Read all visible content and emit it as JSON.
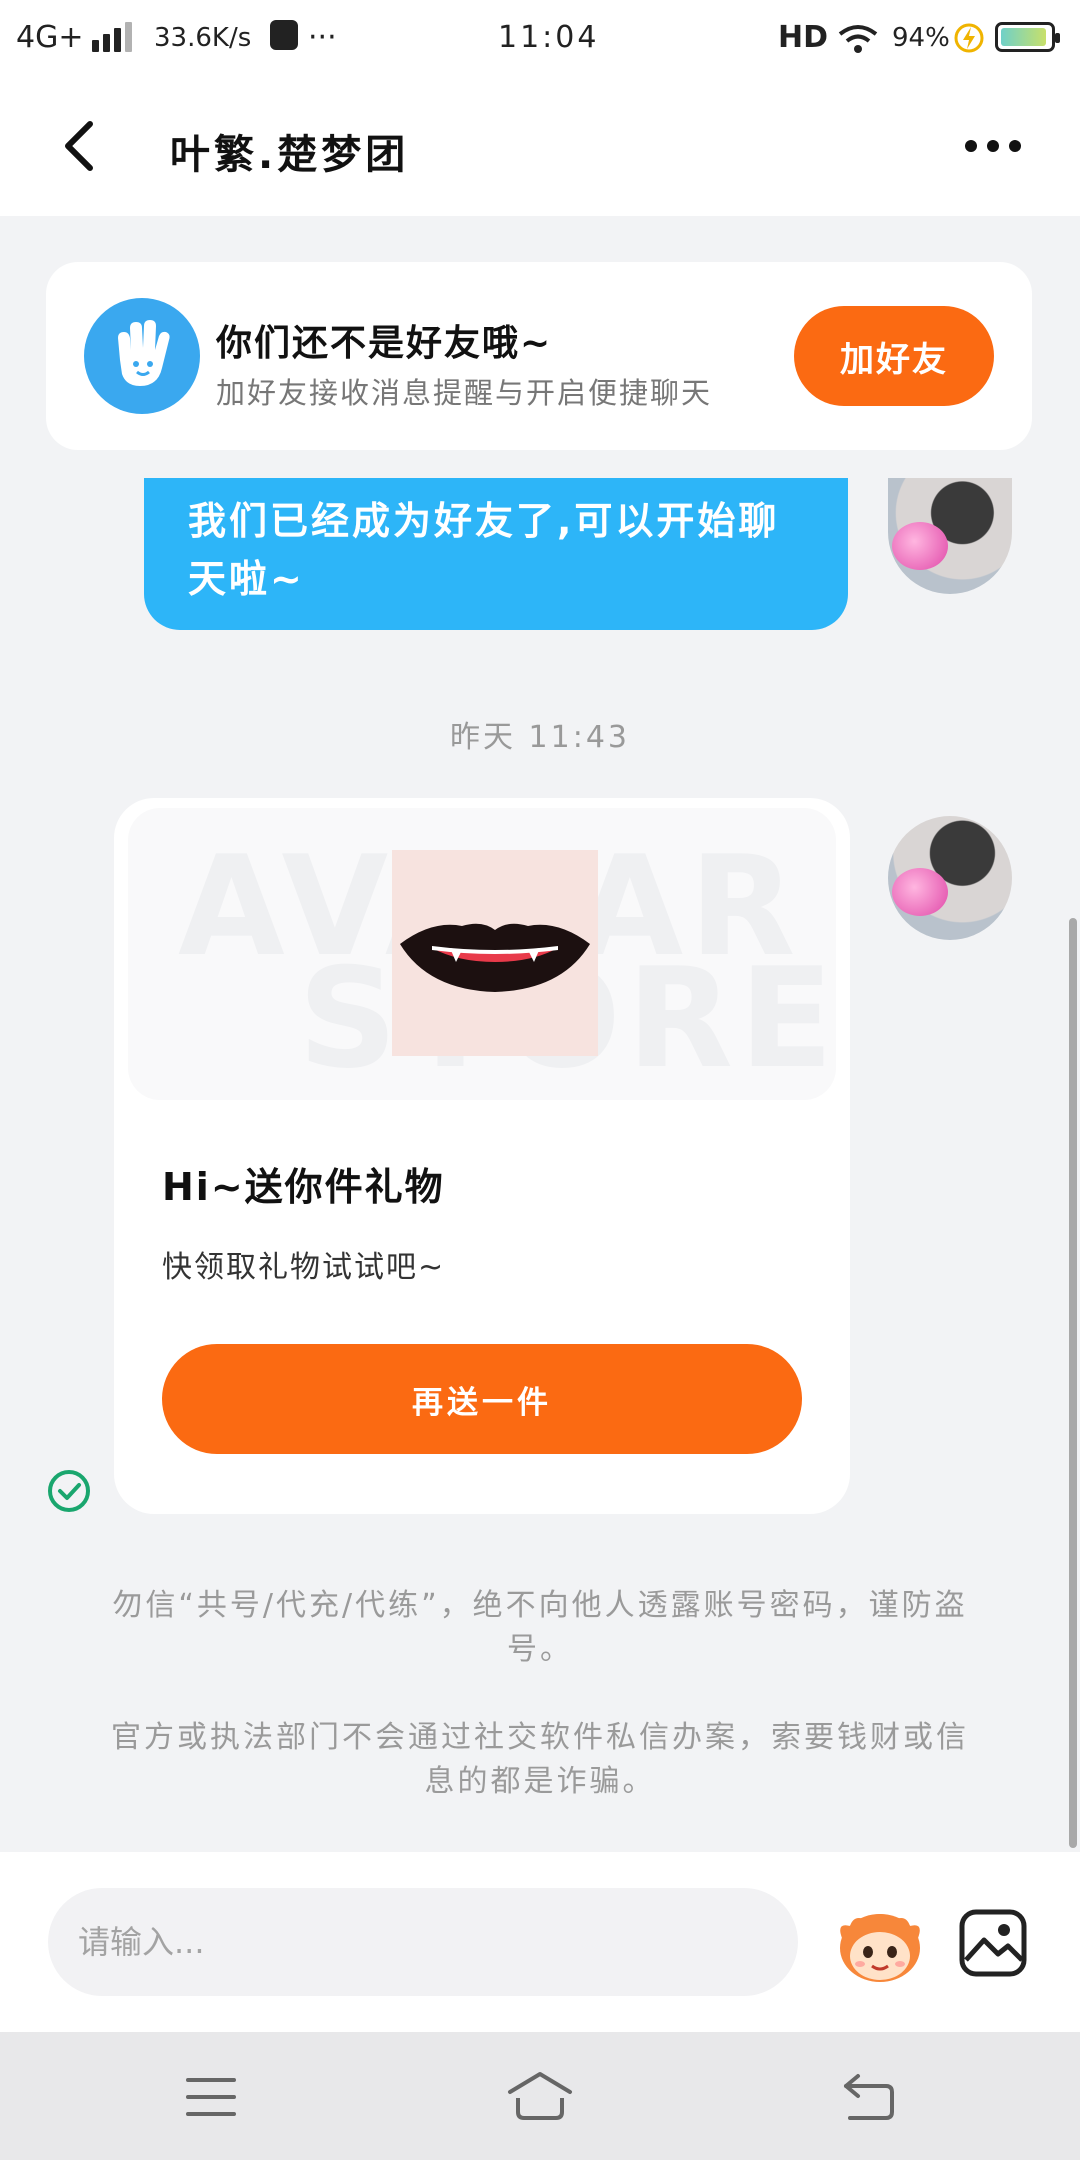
{
  "status_bar": {
    "network": "4G+",
    "speed": "33.6K/s",
    "more": "···",
    "time": "11:04",
    "hd": "HD",
    "battery": "94%",
    "battery_level": 0.94
  },
  "header": {
    "title": "叶繁.楚梦团"
  },
  "friend_prompt": {
    "title": "你们还不是好友哦~",
    "subtitle": "加好友接收消息提醒与开启便捷聊天",
    "button": "加好友"
  },
  "messages": {
    "bubble_text": "我们已经成为好友了,可以开始聊天啦~",
    "timestamp": "昨天 11:43",
    "gift": {
      "watermark_top": "AVATAR",
      "watermark_bottom": "STORE",
      "title": "Hi~送你件礼物",
      "subtitle": "快领取礼物试试吧~",
      "button": "再送一件"
    }
  },
  "notices": [
    "勿信“共号/代充/代练”，绝不向他人透露账号密码，谨防盗号。",
    "官方或执法部门不会通过社交软件私信办案，索要钱财或信息的都是诈骗。"
  ],
  "composer": {
    "placeholder": "请输入..."
  },
  "colors": {
    "accent_orange": "#fb6a12",
    "bubble_blue": "#2db5f8",
    "check_green": "#1aa66e"
  }
}
